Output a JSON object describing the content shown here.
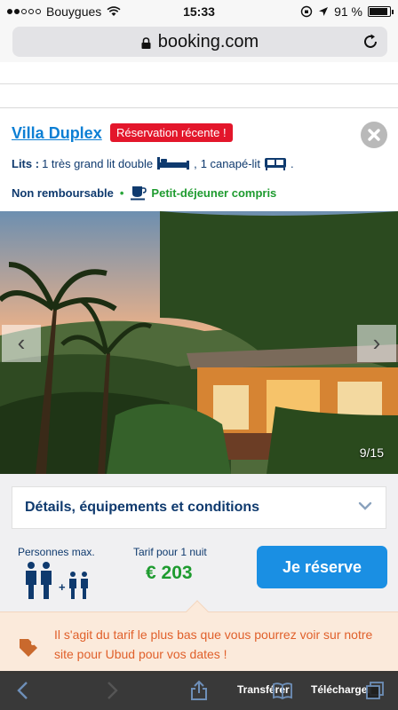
{
  "status_bar": {
    "carrier": "Bouygues",
    "time": "15:33",
    "battery": "91 %"
  },
  "browser": {
    "url": "booking.com"
  },
  "room": {
    "title": "Villa Duplex",
    "badge": "Réservation récente !",
    "beds_label": "Lits :",
    "bed1": "1 très grand lit double",
    "separator": ",",
    "bed2": "1 canapé-lit",
    "period": ".",
    "non_refundable": "Non remboursable",
    "dot": "•",
    "breakfast": "Petit-déjeuner compris"
  },
  "gallery": {
    "counter": "9/15",
    "prev": "‹",
    "next": "›"
  },
  "details": {
    "label": "Détails, équipements et conditions"
  },
  "booking": {
    "persons_label": "Personnes max.",
    "price_label": "Tarif pour 1 nuit",
    "price": "€ 203",
    "reserve_label": "Je réserve",
    "plus": "+"
  },
  "info": {
    "text": "Il s'agit du tarif le plus bas que vous pourrez voir sur notre site pour Ubud pour vos dates !"
  },
  "toolbar": {
    "transfer_label": "Transférer",
    "download_label": "Télécharger"
  },
  "colors": {
    "link_blue": "#0c7fd4",
    "navy": "#0f3a6e",
    "green": "#1e9b2f",
    "badge_red": "#e3162b",
    "button_blue": "#1a8fe3",
    "info_orange": "#e0602b"
  }
}
